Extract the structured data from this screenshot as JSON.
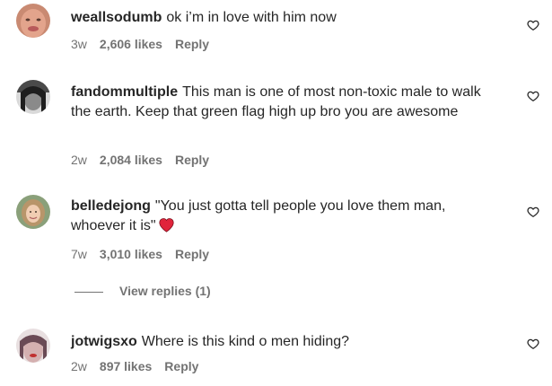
{
  "comments": [
    {
      "username": "weallsodumb",
      "text": "ok i’m in love with him now",
      "time": "3w",
      "likes": "2,606 likes",
      "reply_label": "Reply",
      "avatar_icon": "user-avatar-photo",
      "like_icon": "heart-outline-icon"
    },
    {
      "username": "fandommultiple",
      "text": "This man is one of most non-toxic male to walk the earth. Keep that green flag high up bro you are awesome",
      "time": "2w",
      "likes": "2,084 likes",
      "reply_label": "Reply",
      "avatar_icon": "user-avatar-photo",
      "like_icon": "heart-outline-icon"
    },
    {
      "username": "belledejong",
      "text": "\"You just gotta tell people you love them man, whoever it is\"",
      "emoji": "red-heart-emoji",
      "time": "7w",
      "likes": "3,010 likes",
      "reply_label": "Reply",
      "avatar_icon": "user-avatar-photo",
      "like_icon": "heart-outline-icon",
      "view_replies_label": "View replies (1)"
    },
    {
      "username": "jotwigsxo",
      "text": "Where is this kind o men hiding?",
      "time": "2w",
      "likes": "897 likes",
      "reply_label": "Reply",
      "avatar_icon": "user-avatar-photo",
      "like_icon": "heart-outline-icon"
    }
  ],
  "colors": {
    "text": "#262626",
    "secondary": "#737373",
    "emoji_heart": "#e0243b"
  }
}
